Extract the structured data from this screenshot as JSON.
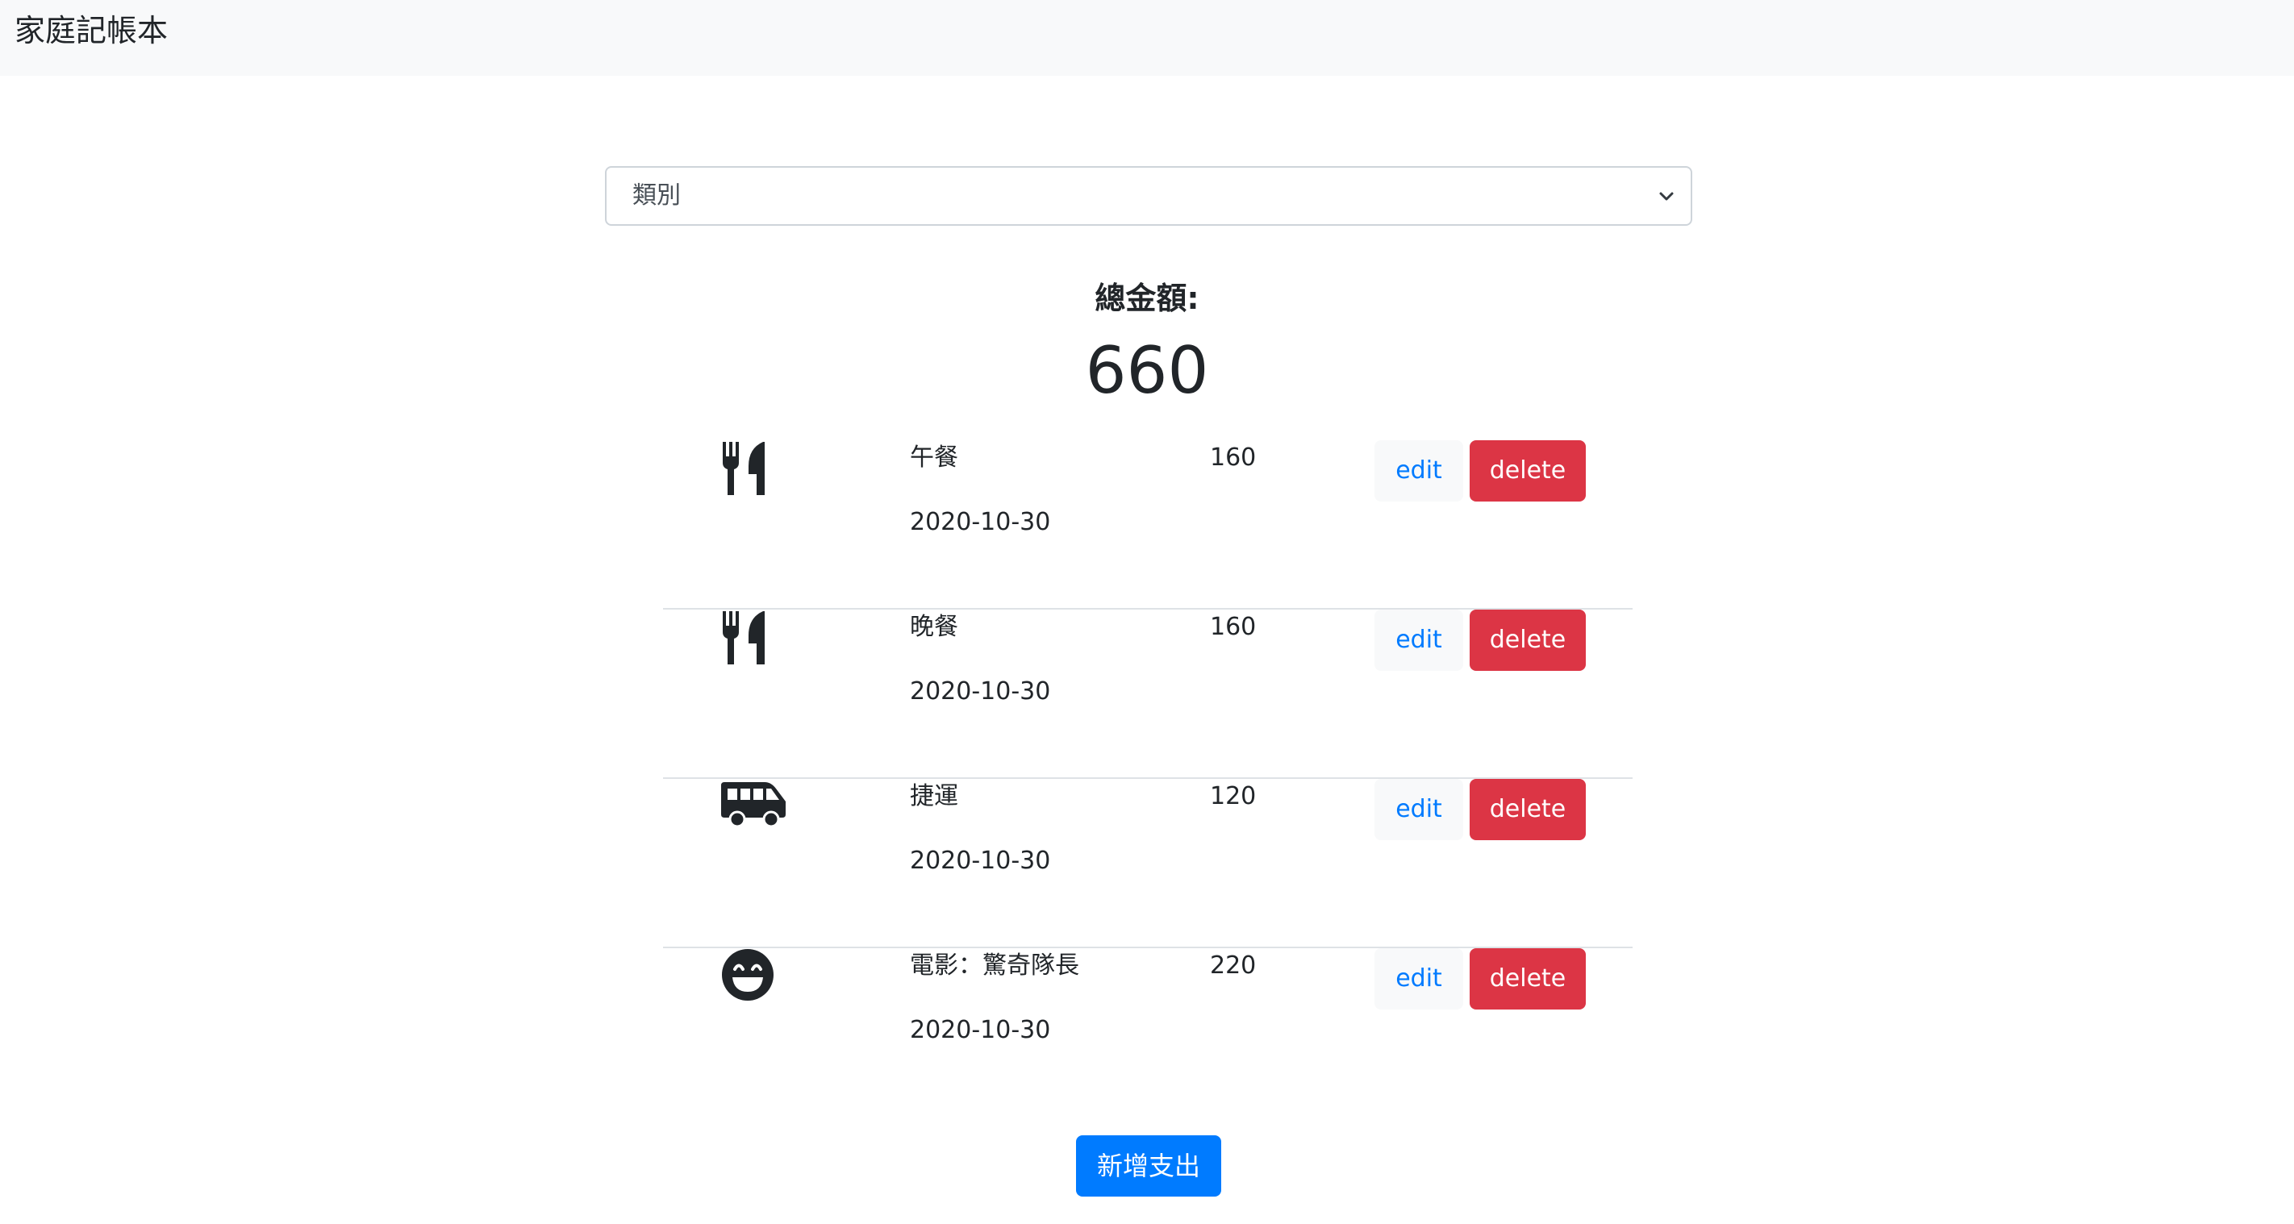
{
  "app": {
    "brand": "家庭記帳本"
  },
  "filter": {
    "selected": "類別"
  },
  "summary": {
    "label": "總金額:",
    "total": "660"
  },
  "records": [
    {
      "icon": "utensils-icon",
      "name": "午餐",
      "amount": "160",
      "date": "2020-10-30",
      "edit_label": "edit",
      "delete_label": "delete"
    },
    {
      "icon": "utensils-icon",
      "name": "晚餐",
      "amount": "160",
      "date": "2020-10-30",
      "edit_label": "edit",
      "delete_label": "delete"
    },
    {
      "icon": "shuttle-van-icon",
      "name": "捷運",
      "amount": "120",
      "date": "2020-10-30",
      "edit_label": "edit",
      "delete_label": "delete"
    },
    {
      "icon": "grin-beam-icon",
      "name": "電影：驚奇隊長",
      "amount": "220",
      "date": "2020-10-30",
      "edit_label": "edit",
      "delete_label": "delete"
    }
  ],
  "actions": {
    "add_label": "新增支出"
  },
  "colors": {
    "primary": "#007bff",
    "danger": "#dc3545",
    "light": "#f8f9fa",
    "text": "#212529"
  }
}
